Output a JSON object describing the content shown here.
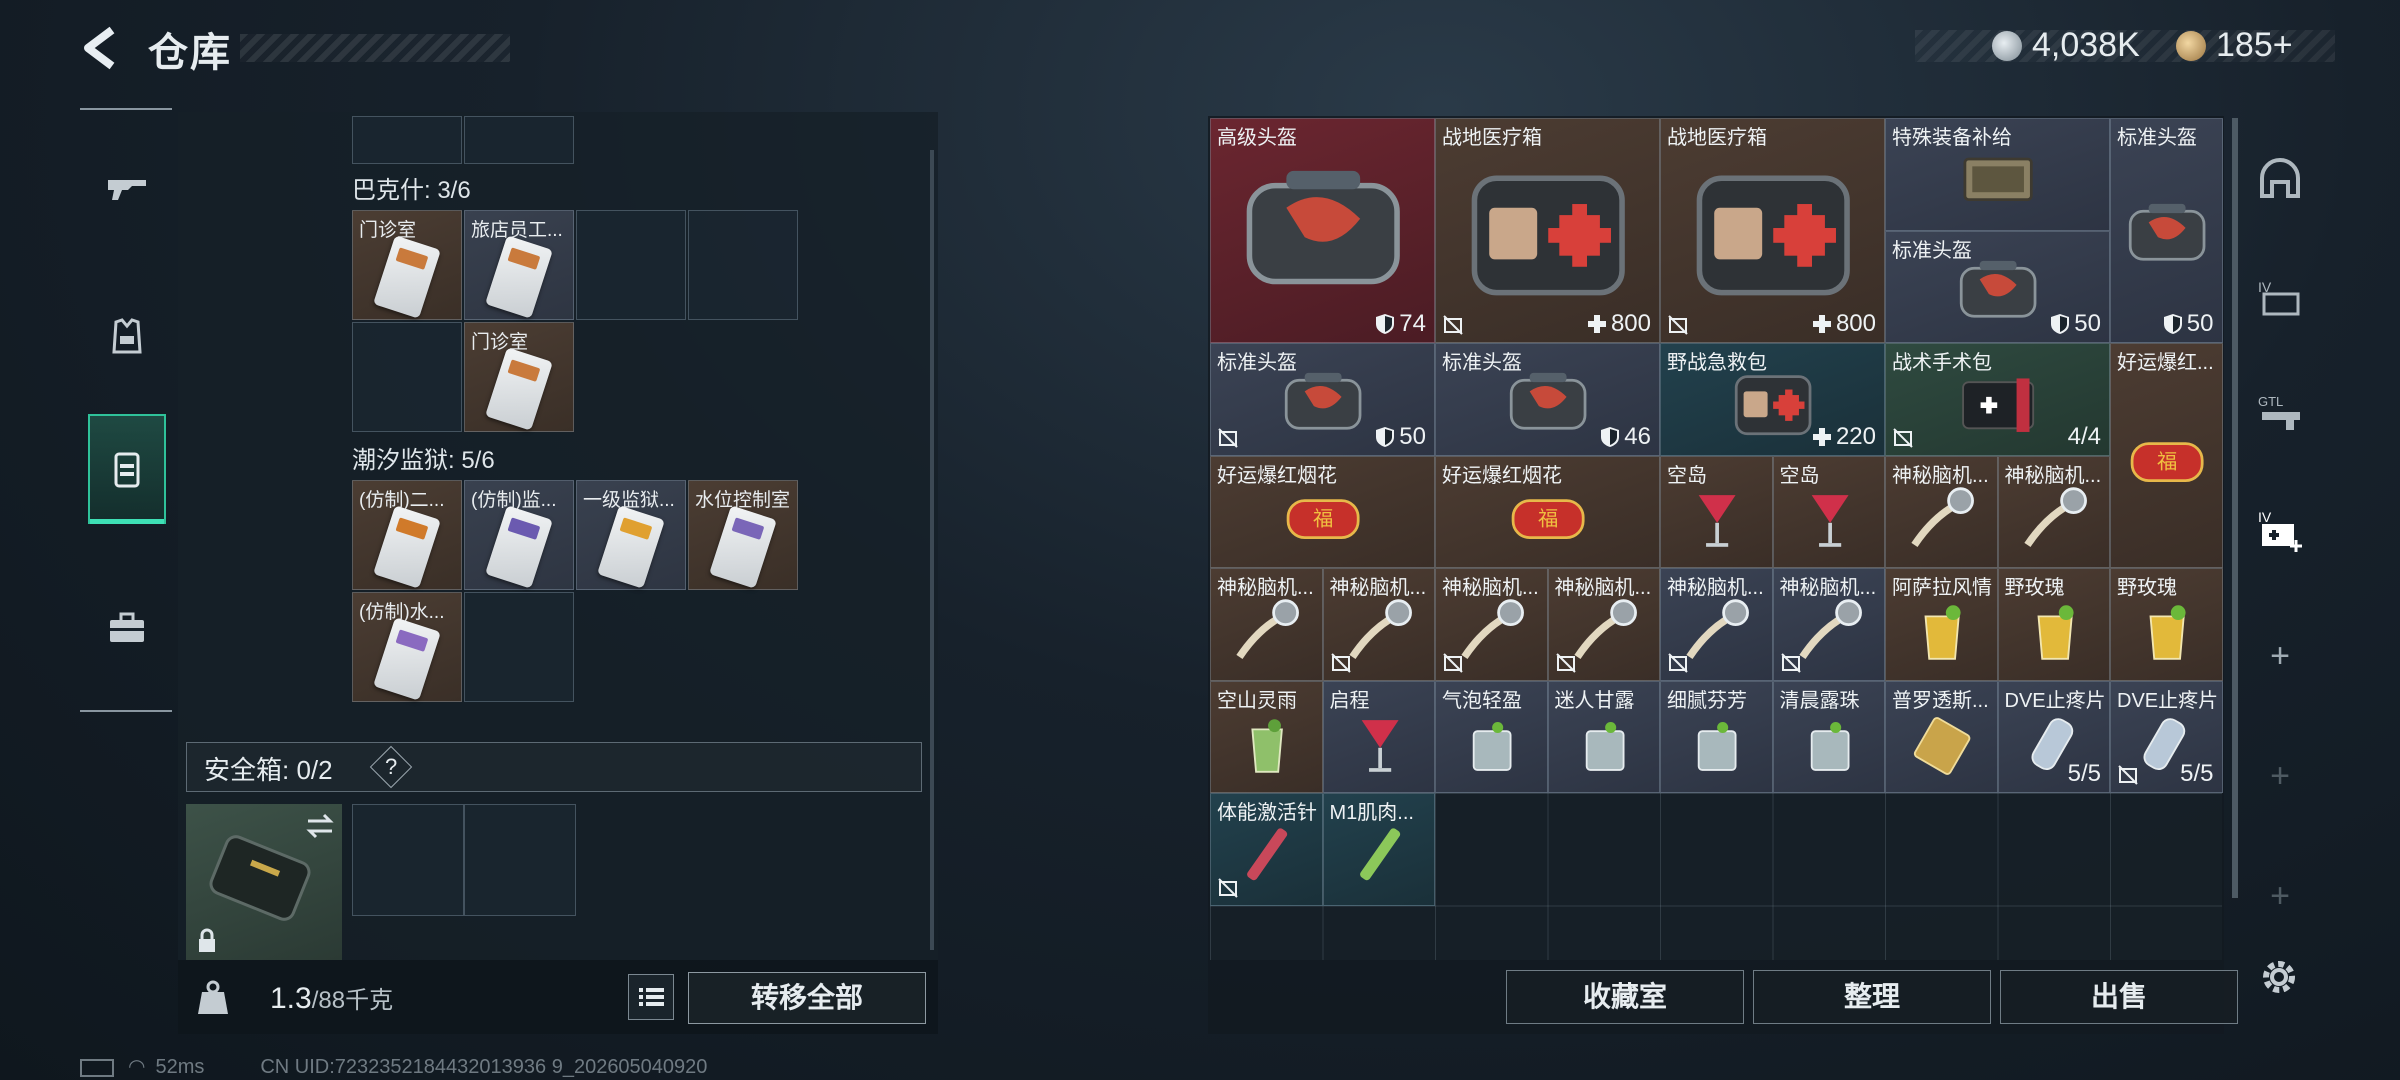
{
  "header": {
    "title": "仓库",
    "back_icon": "back-arrow-icon"
  },
  "currency": {
    "silver": "4,038K",
    "gold": "185+"
  },
  "left_nav": [
    {
      "name": "gun",
      "icon": "gun-icon"
    },
    {
      "name": "armor",
      "icon": "armor-icon"
    },
    {
      "name": "keycard",
      "icon": "keycard-icon",
      "active": true
    },
    {
      "name": "case",
      "icon": "briefcase-icon"
    }
  ],
  "groups": [
    {
      "label": "巴克什: 3/6",
      "items": [
        "门诊室",
        "旅店员工...",
        "门诊室"
      ]
    },
    {
      "label": "潮汐监狱: 5/6",
      "items": [
        "(仿制)二...",
        "(仿制)监...",
        "一级监狱...",
        "水位控制室",
        "(仿制)水..."
      ]
    }
  ],
  "safe": {
    "label": "安全箱: 0/2",
    "help": "?"
  },
  "weight": {
    "current": "1.3",
    "max": "/88千克"
  },
  "buttons": {
    "transfer_all": "转移全部",
    "collection": "收藏室",
    "sort": "整理",
    "sell": "出售"
  },
  "status": {
    "ping": "52ms",
    "uid": "CN UID:7232352184432013936 9_202605040920"
  },
  "stash": [
    {
      "name": "高级头盔",
      "value": "74",
      "kind": "shield"
    },
    {
      "name": "战地医疗箱",
      "value": "800",
      "kind": "heal"
    },
    {
      "name": "战地医疗箱",
      "value": "800",
      "kind": "heal"
    },
    {
      "name": "特殊装备补给",
      "value": "",
      "kind": ""
    },
    {
      "name": "标准头盔",
      "value": "50",
      "kind": "shield"
    },
    {
      "name": "标准头盔",
      "value": "50",
      "kind": "shield"
    },
    {
      "name": "标准头盔",
      "value": "50",
      "kind": "shield"
    },
    {
      "name": "标准头盔",
      "value": "46",
      "kind": "shield"
    },
    {
      "name": "野战急救包",
      "value": "220",
      "kind": "heal"
    },
    {
      "name": "战术手术包",
      "value": "4/4",
      "kind": ""
    },
    {
      "name": "好运爆红...",
      "value": "",
      "kind": ""
    },
    {
      "name": "好运爆红烟花",
      "value": "",
      "kind": ""
    },
    {
      "name": "好运爆红烟花",
      "value": "",
      "kind": ""
    },
    {
      "name": "空岛",
      "value": "",
      "kind": ""
    },
    {
      "name": "空岛",
      "value": "",
      "kind": ""
    },
    {
      "name": "神秘脑机...",
      "value": "",
      "kind": ""
    },
    {
      "name": "神秘脑机...",
      "value": "",
      "kind": ""
    },
    {
      "name": "神秘脑机...",
      "value": "",
      "kind": ""
    },
    {
      "name": "神秘脑机...",
      "value": "",
      "kind": ""
    },
    {
      "name": "神秘脑机...",
      "value": "",
      "kind": ""
    },
    {
      "name": "神秘脑机...",
      "value": "",
      "kind": ""
    },
    {
      "name": "神秘脑机...",
      "value": "",
      "kind": ""
    },
    {
      "name": "神秘脑机...",
      "value": "",
      "kind": ""
    },
    {
      "name": "阿萨拉风情",
      "value": "",
      "kind": ""
    },
    {
      "name": "野玫瑰",
      "value": "",
      "kind": ""
    },
    {
      "name": "野玫瑰",
      "value": "",
      "kind": ""
    },
    {
      "name": "空山灵雨",
      "value": "",
      "kind": ""
    },
    {
      "name": "启程",
      "value": "",
      "kind": ""
    },
    {
      "name": "气泡轻盈",
      "value": "",
      "kind": ""
    },
    {
      "name": "迷人甘露",
      "value": "",
      "kind": ""
    },
    {
      "name": "细腻芬芳",
      "value": "",
      "kind": ""
    },
    {
      "name": "清晨露珠",
      "value": "",
      "kind": ""
    },
    {
      "name": "普罗透斯...",
      "value": "",
      "kind": ""
    },
    {
      "name": "DVE止疼片",
      "value": "5/5",
      "kind": ""
    },
    {
      "name": "DVE止疼片",
      "value": "5/5",
      "kind": ""
    },
    {
      "name": "体能激活针",
      "value": "",
      "kind": ""
    },
    {
      "name": "M1肌肉...",
      "value": "",
      "kind": ""
    }
  ]
}
